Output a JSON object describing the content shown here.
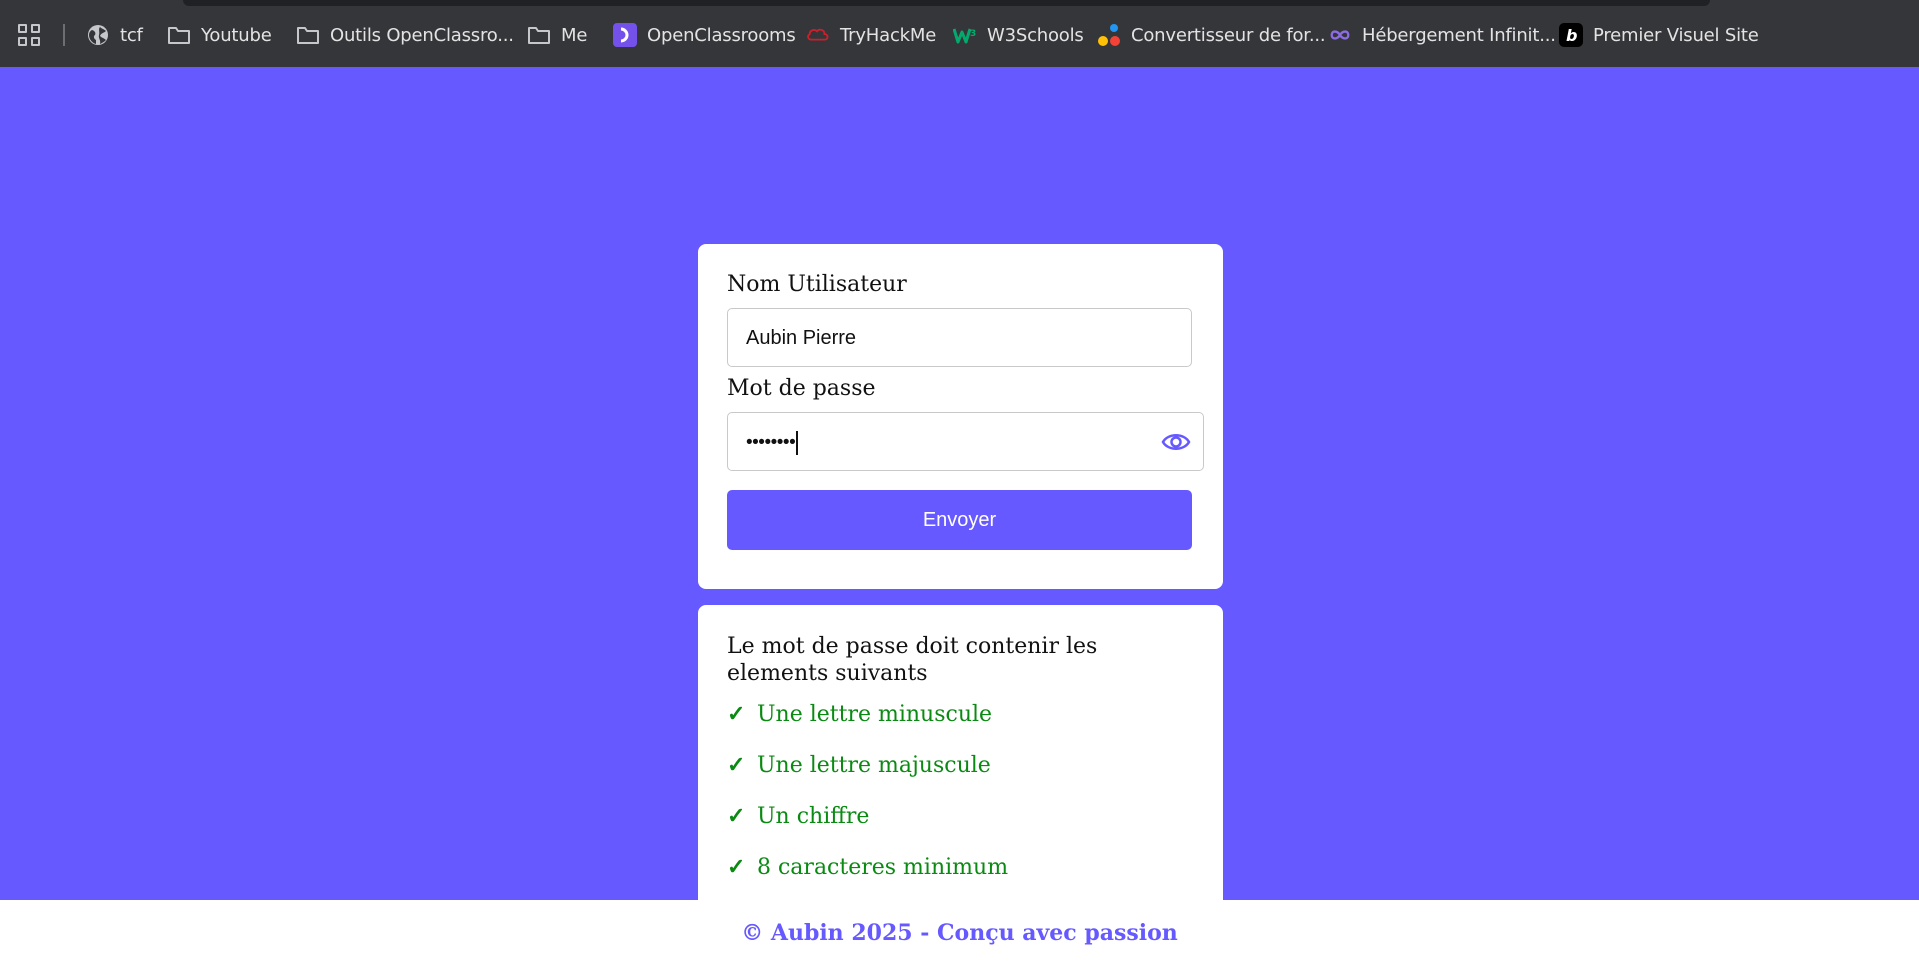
{
  "bookmarks": [
    {
      "label": "tcf",
      "icon": "globe-icon"
    },
    {
      "label": "Youtube",
      "icon": "folder-icon"
    },
    {
      "label": "Outils OpenClassro...",
      "icon": "folder-icon"
    },
    {
      "label": "Me",
      "icon": "folder-icon"
    },
    {
      "label": "OpenClassrooms",
      "icon": "openclassrooms-logo-icon"
    },
    {
      "label": "TryHackMe",
      "icon": "tryhackme-logo-icon"
    },
    {
      "label": "W3Schools",
      "icon": "w3schools-logo-icon"
    },
    {
      "label": "Convertisseur de for...",
      "icon": "dots-logo-icon"
    },
    {
      "label": "Hébergement Infinit...",
      "icon": "infinity-icon"
    },
    {
      "label": "Premier Visuel Site",
      "icon": "b-logo-icon"
    }
  ],
  "form": {
    "username_label": "Nom Utilisateur",
    "username_value": "Aubin Pierre",
    "password_label": "Mot de passe",
    "password_value": "••••••••",
    "submit_label": "Envoyer"
  },
  "requirements": {
    "title": "Le mot de passe doit contenir les elements suivants",
    "check_glyph": "✓",
    "items": [
      {
        "label": "Une lettre minuscule",
        "met": true
      },
      {
        "label": "Une lettre majuscule",
        "met": true
      },
      {
        "label": "Un chiffre",
        "met": true
      },
      {
        "label": "8 caracteres minimum",
        "met": true
      }
    ]
  },
  "footer": {
    "text": "© Aubin 2025 - Conçu avec passion"
  },
  "colors": {
    "accent": "#6559ff",
    "success": "#0a8a12",
    "toolbar": "#35363a"
  }
}
